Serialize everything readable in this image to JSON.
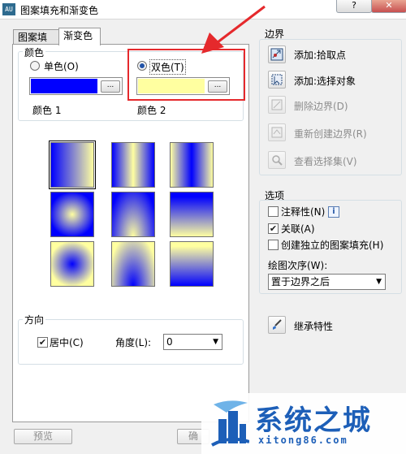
{
  "window": {
    "title": "图案填充和渐变色",
    "app_icon_text": "AU",
    "help_button": "?",
    "close_button": "✕"
  },
  "tabs": [
    {
      "label": "图案填充",
      "active": false
    },
    {
      "label": "渐变色",
      "active": true
    }
  ],
  "color_group": {
    "title": "颜色",
    "single_label": "单色(O)",
    "dual_label": "双色(T)",
    "selected": "双色",
    "color1_label": "颜色 1",
    "color2_label": "颜色 2",
    "color1": "#0000ff",
    "color2": "#ffffa0",
    "browse_label": "..."
  },
  "gradient_patterns": [
    {
      "name": "linear-horizontal",
      "selected": true
    },
    {
      "name": "cylinder-horizontal",
      "selected": false
    },
    {
      "name": "inverted-cylinder-horizontal",
      "selected": false
    },
    {
      "name": "spherical",
      "selected": false
    },
    {
      "name": "hemispherical",
      "selected": false
    },
    {
      "name": "curved",
      "selected": false
    },
    {
      "name": "inverted-spherical",
      "selected": false
    },
    {
      "name": "inverted-hemispherical",
      "selected": false
    },
    {
      "name": "inverted-curved",
      "selected": false
    }
  ],
  "orientation_group": {
    "title": "方向",
    "centered_label": "居中(C)",
    "centered_checked": true,
    "angle_label": "角度(L):",
    "angle_value": "0"
  },
  "boundaries": {
    "title": "边界",
    "add_pick_points": "添加:拾取点",
    "add_select_objects": "添加:选择对象",
    "remove_boundaries": "删除边界(D)",
    "recreate_boundary": "重新创建边界(R)",
    "view_selections": "查看选择集(V)"
  },
  "options": {
    "title": "选项",
    "annotative_label": "注释性(N)",
    "annotative_checked": false,
    "info_icon": "i",
    "associative_label": "关联(A)",
    "associative_checked": true,
    "separate_hatches_label": "创建独立的图案填充(H)",
    "separate_hatches_checked": false,
    "draw_order_label": "绘图次序(W):",
    "draw_order_value": "置于边界之后"
  },
  "inherit_properties": "继承特性",
  "buttons": {
    "preview": "预览",
    "ok_partial": "确"
  },
  "watermark": {
    "title": "系统之城",
    "url": "xitong86.com"
  },
  "colors": {
    "highlight": "#e5292c",
    "blue": "#0000ff",
    "yellow": "#ffffa0"
  }
}
